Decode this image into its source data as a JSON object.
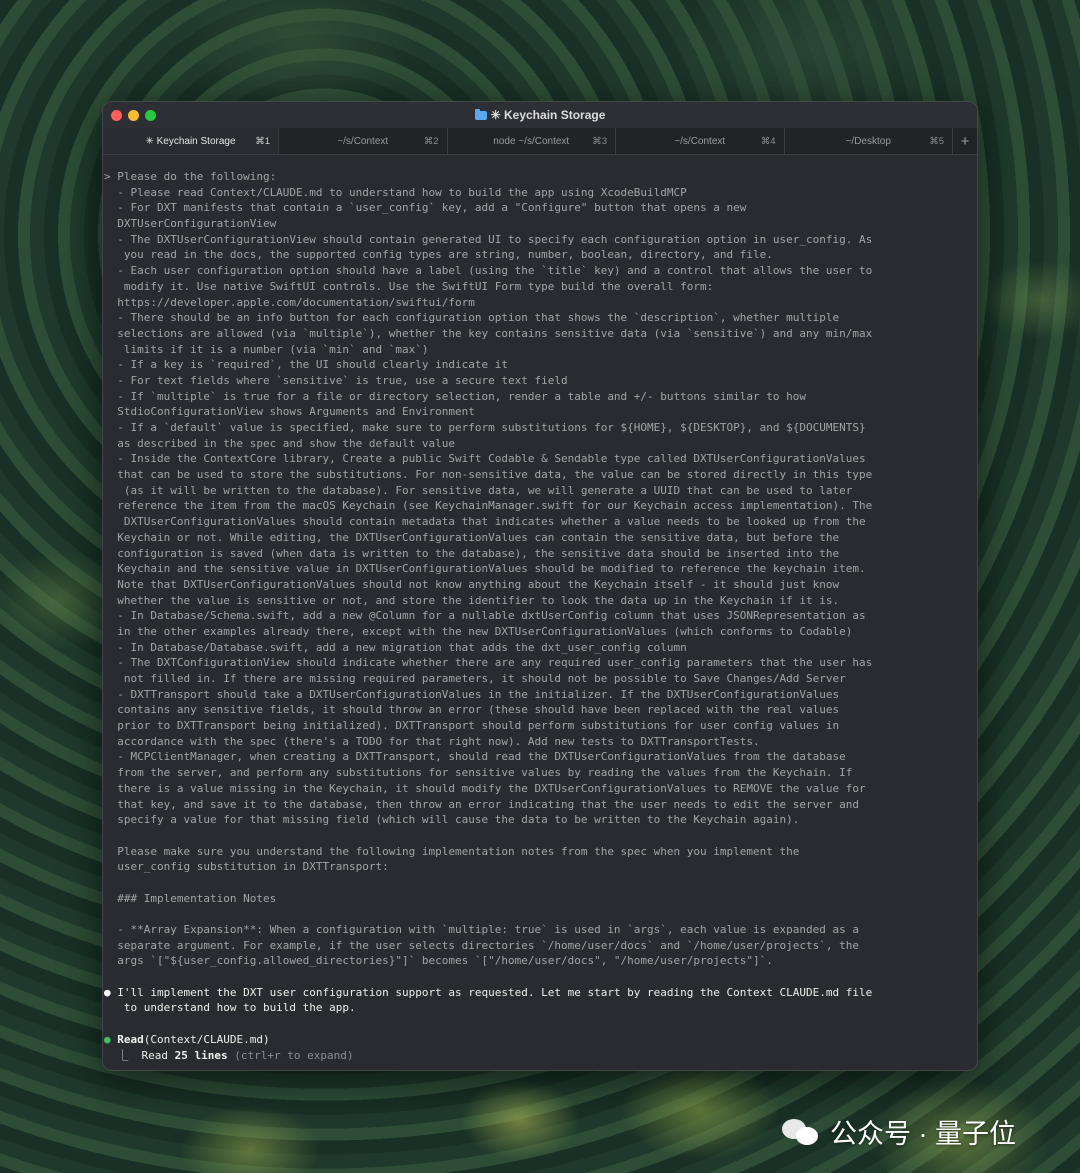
{
  "window": {
    "title": "✳ Keychain Storage",
    "tabs": [
      {
        "label": "✳ Keychain Storage",
        "shortcut": "⌘1",
        "active": true
      },
      {
        "label": "~/s/Context",
        "shortcut": "⌘2",
        "active": false
      },
      {
        "label": "node ~/s/Context",
        "shortcut": "⌘3",
        "active": false
      },
      {
        "label": "~/s/Context",
        "shortcut": "⌘4",
        "active": false
      },
      {
        "label": "~/Desktop",
        "shortcut": "⌘5",
        "active": false
      }
    ],
    "new_tab_label": "+"
  },
  "terminal": {
    "prompt_lines": [
      "> Please do the following:",
      "  - Please read Context/CLAUDE.md to understand how to build the app using XcodeBuildMCP",
      "  - For DXT manifests that contain a `user_config` key, add a \"Configure\" button that opens a new",
      "  DXTUserConfigurationView",
      "  - The DXTUserConfigurationView should contain generated UI to specify each configuration option in user_config. As",
      "   you read in the docs, the supported config types are string, number, boolean, directory, and file.",
      "  - Each user configuration option should have a label (using the `title` key) and a control that allows the user to",
      "   modify it. Use native SwiftUI controls. Use the SwiftUI Form type build the overall form:",
      "  https://developer.apple.com/documentation/swiftui/form",
      "  - There should be an info button for each configuration option that shows the `description`, whether multiple",
      "  selections are allowed (via `multiple`), whether the key contains sensitive data (via `sensitive`) and any min/max",
      "   limits if it is a number (via `min` and `max`)",
      "  - If a key is `required`, the UI should clearly indicate it",
      "  - For text fields where `sensitive` is true, use a secure text field",
      "  - If `multiple` is true for a file or directory selection, render a table and +/- buttons similar to how",
      "  StdioConfigurationView shows Arguments and Environment",
      "  - If a `default` value is specified, make sure to perform substitutions for ${HOME}, ${DESKTOP}, and ${DOCUMENTS}",
      "  as described in the spec and show the default value",
      "  - Inside the ContextCore library, Create a public Swift Codable & Sendable type called DXTUserConfigurationValues",
      "  that can be used to store the substitutions. For non-sensitive data, the value can be stored directly in this type",
      "   (as it will be written to the database). For sensitive data, we will generate a UUID that can be used to later",
      "  reference the item from the macOS Keychain (see KeychainManager.swift for our Keychain access implementation). The",
      "   DXTUserConfigurationValues should contain metadata that indicates whether a value needs to be looked up from the",
      "  Keychain or not. While editing, the DXTUserConfigurationValues can contain the sensitive data, but before the",
      "  configuration is saved (when data is written to the database), the sensitive data should be inserted into the",
      "  Keychain and the sensitive value in DXTUserConfigurationValues should be modified to reference the keychain item.",
      "  Note that DXTUserConfigurationValues should not know anything about the Keychain itself - it should just know",
      "  whether the value is sensitive or not, and store the identifier to look the data up in the Keychain if it is.",
      "  - In Database/Schema.swift, add a new @Column for a nullable dxtUserConfig column that uses JSONRepresentation as",
      "  in the other examples already there, except with the new DXTUserConfigurationValues (which conforms to Codable)",
      "  - In Database/Database.swift, add a new migration that adds the dxt_user_config column",
      "  - The DXTConfigurationView should indicate whether there are any required user_config parameters that the user has",
      "   not filled in. If there are missing required parameters, it should not be possible to Save Changes/Add Server",
      "  - DXTTransport should take a DXTUserConfigurationValues in the initializer. If the DXTUserConfigurationValues",
      "  contains any sensitive fields, it should throw an error (these should have been replaced with the real values",
      "  prior to DXTTransport being initialized). DXTTransport should perform substitutions for user config values in",
      "  accordance with the spec (there's a TODO for that right now). Add new tests to DXTTransportTests.",
      "  - MCPClientManager, when creating a DXTTransport, should read the DXTUserConfigurationValues from the database",
      "  from the server, and perform any substitutions for sensitive values by reading the values from the Keychain. If",
      "  there is a value missing in the Keychain, it should modify the DXTUserConfigurationValues to REMOVE the value for",
      "  that key, and save it to the database, then throw an error indicating that the user needs to edit the server and",
      "  specify a value for that missing field (which will cause the data to be written to the Keychain again).",
      "",
      "  Please make sure you understand the following implementation notes from the spec when you implement the",
      "  user_config substitution in DXTTransport:",
      "",
      "  ### Implementation Notes",
      "",
      "  - **Array Expansion**: When a configuration with `multiple: true` is used in `args`, each value is expanded as a",
      "  separate argument. For example, if the user selects directories `/home/user/docs` and `/home/user/projects`, the",
      "  args `[\"${user_config.allowed_directories}\"]` becomes `[\"/home/user/docs\", \"/home/user/projects\"]`.",
      ""
    ],
    "response": {
      "bullet": "●",
      "line1": "I'll implement the DXT user configuration support as requested. Let me start by reading the Context CLAUDE.md file",
      "line2": "   to understand how to build the app."
    },
    "tool_call": {
      "bullet": "●",
      "tool_name": "Read",
      "args": "(Context/CLAUDE.md)",
      "result_prefix": "  ⎿  ",
      "result_label": "Read ",
      "result_count": "25",
      "result_suffix": " lines",
      "expand_hint": " (ctrl+r to expand)"
    }
  },
  "watermark": {
    "text": "公众号 · 量子位"
  },
  "colors": {
    "close": "#ff5f57",
    "minimize": "#febc2e",
    "zoom": "#28c840",
    "tool_bullet": "#3fc15a"
  }
}
